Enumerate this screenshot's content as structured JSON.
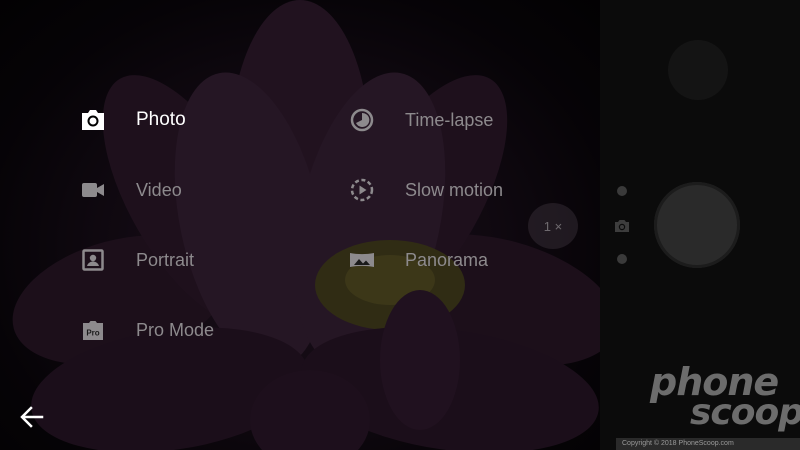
{
  "modes": {
    "photo": {
      "label": "Photo",
      "icon": "camera-icon",
      "selected": true
    },
    "video": {
      "label": "Video",
      "icon": "video-camera-icon"
    },
    "portrait": {
      "label": "Portrait",
      "icon": "portrait-icon"
    },
    "pro_mode": {
      "label": "Pro Mode",
      "icon": "pro-icon",
      "badge": "Pro"
    },
    "time_lapse": {
      "label": "Time-lapse",
      "icon": "time-lapse-icon"
    },
    "slow_motion": {
      "label": "Slow motion",
      "icon": "slow-motion-icon"
    },
    "panorama": {
      "label": "Panorama",
      "icon": "panorama-icon"
    }
  },
  "zoom": {
    "label": "1 ×"
  },
  "watermark": {
    "line1": "phone",
    "line2": "scoop",
    "copyright": "Copyright © 2018 PhoneScoop.com"
  },
  "colors": {
    "selected_text": "#ffffff",
    "unselected_text": "#8d8a8d",
    "panel_bg": "#0b0b0b"
  }
}
